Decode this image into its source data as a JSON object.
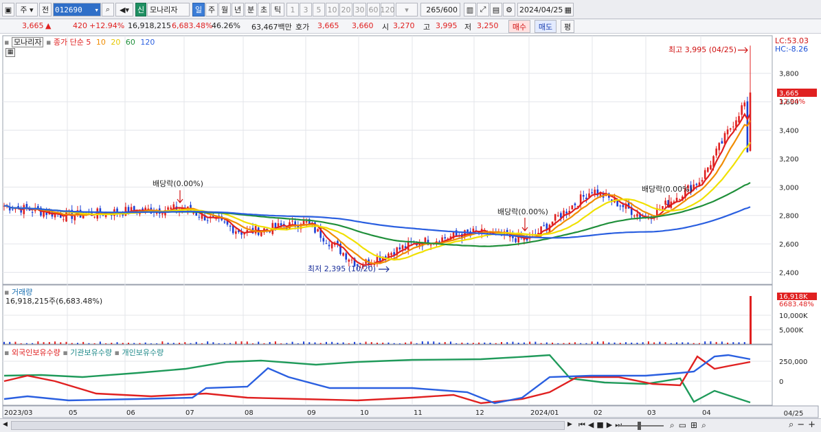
{
  "toolbar": {
    "market_label": "주",
    "prev_label": "전",
    "stock_code": "012690",
    "stock_badge": "신",
    "stock_name": "모나리자",
    "periods": [
      "일",
      "주",
      "월",
      "년",
      "분",
      "초",
      "틱"
    ],
    "active_period": "일",
    "intervals": [
      "1",
      "3",
      "5",
      "10",
      "20",
      "30",
      "60",
      "120"
    ],
    "data_count": "265",
    "data_max": "/600",
    "date": "2024/04/25"
  },
  "quote": {
    "price": "3,665",
    "change_arrow": "▲",
    "change": "420",
    "change_pct": "+12.94%",
    "volume": "16,918,215",
    "volume_ratio": "6,683.48%",
    "turnover": "46.26%",
    "amount": "63,467백만",
    "hoga_label": "호가",
    "hoga_ask": "3,665",
    "hoga_bid": "3,660",
    "open_label": "시",
    "open": "3,270",
    "high_label": "고",
    "high": "3,995",
    "low_label": "저",
    "low": "3,250",
    "buy_label": "매수",
    "sell_label": "매도",
    "eval_label": "평"
  },
  "price_panel": {
    "stock_label": "모나리자",
    "ma_label": "종가 단순",
    "ma_periods": [
      "5",
      "10",
      "20",
      "60",
      "120"
    ],
    "ma_colors": [
      "#e02020",
      "#f08c00",
      "#f0e000",
      "#1f8f3a",
      "#2a5fe0"
    ],
    "lc": "LC:53.03",
    "hc": "HC:-8.26",
    "current_price": "3,665",
    "current_pct": "12.94%",
    "y_ticks": [
      "3,800",
      "3,600",
      "3,400",
      "3,200",
      "3,000",
      "2,800",
      "2,600",
      "2,400"
    ],
    "high_note": "최고 3,995 (04/25)",
    "low_note": "최저 2,395 (10/20)",
    "dividend_notes": [
      "배당락(0.00%)",
      "배당락(0.00%)",
      "배당락(0.00%)"
    ]
  },
  "volume_panel": {
    "title": "거래량",
    "summary": "16,918,215주(6,683.48%)",
    "current": "16,918K",
    "current_pct": "6683.48%",
    "y_ticks": [
      "10,000K",
      "5,000K"
    ]
  },
  "holding_panel": {
    "series_labels": [
      "외국인보유수량",
      "기관보유수량",
      "개인보유수량"
    ],
    "series_colors": [
      "#e02020",
      "#1f9a5a",
      "#2a5fe0"
    ],
    "y_ticks": [
      "250,000",
      "0"
    ]
  },
  "x_axis": {
    "labels": [
      "2023/03",
      "05",
      "06",
      "07",
      "08",
      "09",
      "10",
      "11",
      "12",
      "2024/01",
      "02",
      "03",
      "04"
    ],
    "end_label": "04/25"
  },
  "chart_data": {
    "type": "line",
    "title": "모나리자",
    "x": [
      "2023/03",
      "2023/05",
      "2023/06",
      "2023/07",
      "2023/08",
      "2023/09",
      "2023/10",
      "2023/11",
      "2023/12",
      "2024/01",
      "2024/02",
      "2024/03",
      "2024/04",
      "2024/04/25"
    ],
    "series": [
      {
        "name": "종가",
        "values": [
          2870,
          2800,
          2830,
          2850,
          2680,
          2750,
          2450,
          2600,
          2680,
          2630,
          2980,
          2780,
          3050,
          3665
        ]
      }
    ],
    "ylim": [
      2330,
      4050
    ],
    "high": 3995,
    "low": 2395
  }
}
